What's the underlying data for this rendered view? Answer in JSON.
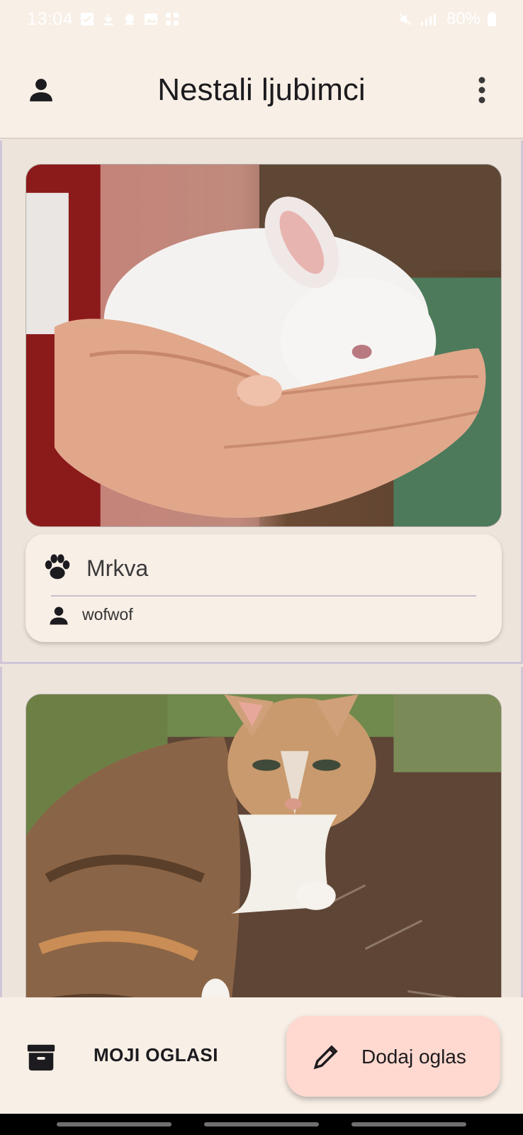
{
  "status_bar": {
    "time": "13:04",
    "battery": "80%",
    "icons_left": [
      "checkbox-icon",
      "download-icon",
      "tag-icon",
      "image-icon",
      "grid-icon"
    ],
    "icons_right": [
      "mute-icon",
      "signal-icon",
      "battery-icon"
    ]
  },
  "app_bar": {
    "title": "Nestali ljubimci"
  },
  "posts": [
    {
      "image": "white-rabbit-in-hands",
      "pet_name": "Mrkva",
      "owner": "wofwof"
    },
    {
      "image": "calico-cat"
    }
  ],
  "bottom_bar": {
    "my_ads_label": "MOJI OGLASI",
    "add_ad_label": "Dodaj oglas"
  },
  "colors": {
    "surface": "#f8efe6",
    "background": "#ede5dc",
    "fab": "#ffd9cf",
    "divider": "#cfc6d6"
  }
}
